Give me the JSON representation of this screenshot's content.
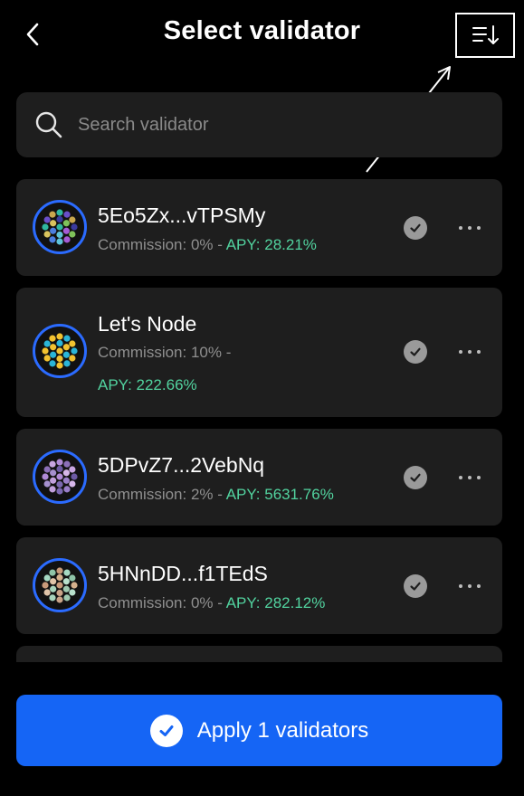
{
  "header": {
    "title": "Select validator",
    "back_icon": "chevron-left-icon",
    "sort_icon": "sort-descending-icon"
  },
  "search": {
    "placeholder": "Search validator",
    "value": ""
  },
  "validators": [
    {
      "name": "5Eo5Zx...vTPSMy",
      "commission": "Commission: 0% -",
      "apy": "APY: 28.21%",
      "selected": true,
      "identicon_colors": [
        "#2fb7a0",
        "#6a4ec9",
        "#c9a84e",
        "#3a3a9e",
        "#7fc25a",
        "#a55cd6",
        "#5ec2d9",
        "#4c7fe0",
        "#d9c45e"
      ]
    },
    {
      "name": "Let's Node",
      "commission": "Commission: 10% -",
      "apy": "APY: 222.66%",
      "selected": true,
      "identicon_colors": [
        "#f2c230",
        "#2bb5d8",
        "#f2c230",
        "#2bb5d8",
        "#f2c230",
        "#2bb5d8",
        "#f2c230",
        "#2bb5d8",
        "#f2c230"
      ]
    },
    {
      "name": "5DPvZ7...2VebNq",
      "commission": "Commission: 2% -",
      "apy": "APY: 5631.76%",
      "selected": true,
      "identicon_colors": [
        "#b08ad6",
        "#8c6fb8",
        "#c9a6e0",
        "#6d5aa3",
        "#d6b6e8",
        "#9a7fc9",
        "#7b68b0",
        "#c2a0dc",
        "#a690cf"
      ]
    },
    {
      "name": "5HNnDD...f1TEdS",
      "commission": "Commission: 0% -",
      "apy": "APY: 282.12%",
      "selected": true,
      "identicon_colors": [
        "#c89a7a",
        "#a6d9c2",
        "#8fc4a8",
        "#d4b08c",
        "#b8e0cc",
        "#9ec9b0",
        "#c9a388",
        "#a8d4bc",
        "#e0c4a8"
      ]
    }
  ],
  "apply_button": {
    "label": "Apply 1 validators",
    "icon": "check-circle-icon"
  },
  "colors": {
    "background": "#000000",
    "card": "#1e1e1e",
    "accent_blue": "#1565f5",
    "apy_green": "#52d39f",
    "muted_text": "#8f8f8f"
  }
}
